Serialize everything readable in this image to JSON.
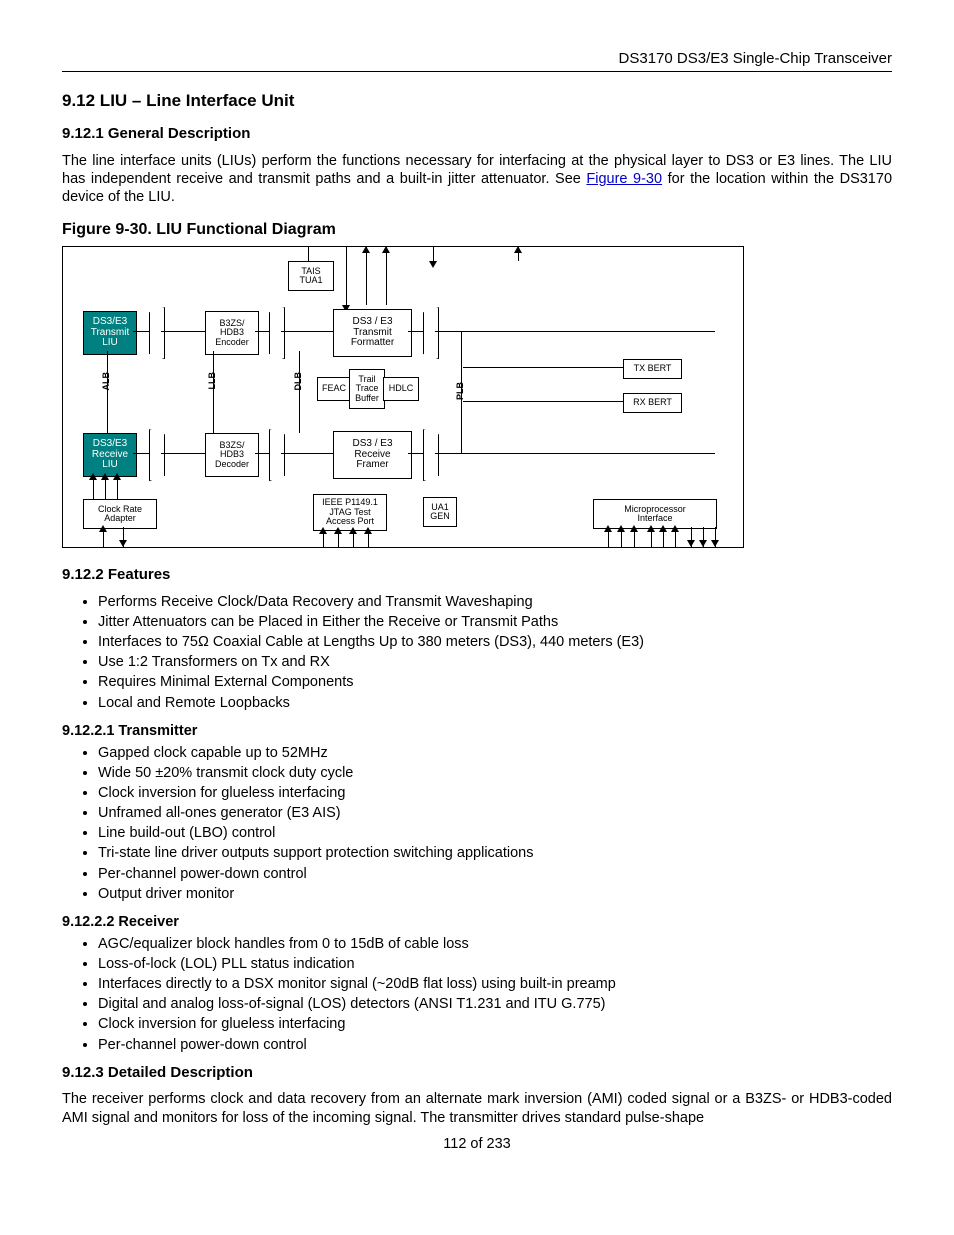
{
  "header": {
    "doc_title": "DS3170 DS3/E3 Single-Chip Transceiver"
  },
  "sec": {
    "h_9_12": "9.12  LIU – Line Interface Unit",
    "h_9_12_1": "9.12.1  General Description",
    "p_9_12_1": "The line interface units (LIUs) perform the functions necessary for interfacing at the physical layer to DS3 or E3 lines. The LIU has independent receive and transmit paths and a built-in jitter attenuator. See ",
    "link_fig": "Figure 9-30",
    "p_9_12_1_tail": " for the location within the DS3170 device of the LIU.",
    "fig_title": "Figure 9-30. LIU Functional Diagram",
    "h_9_12_2": "9.12.2  Features",
    "features": [
      "Performs Receive Clock/Data Recovery and Transmit Waveshaping",
      "Jitter Attenuators can be Placed in Either the Receive or Transmit Paths",
      "Interfaces to 75Ω Coaxial Cable at Lengths Up to 380 meters (DS3), 440 meters (E3)",
      "Use 1:2 Transformers on Tx and RX",
      "Requires Minimal External Components",
      "Local and Remote Loopbacks"
    ],
    "h_9_12_2_1": "9.12.2.1   Transmitter",
    "tx_features": [
      "Gapped clock capable up to 52MHz",
      "Wide 50 ±20% transmit clock duty cycle",
      "Clock inversion for glueless interfacing",
      "Unframed all-ones generator (E3 AIS)",
      "Line build-out (LBO) control",
      "Tri-state line driver outputs support protection switching applications",
      "Per-channel power-down control",
      "Output driver monitor"
    ],
    "h_9_12_2_2": "9.12.2.2   Receiver",
    "rx_features": [
      "AGC/equalizer block handles from 0 to 15dB of cable loss",
      "Loss-of-lock (LOL) PLL status indication",
      "Interfaces directly to a DSX monitor signal (~20dB flat loss) using built-in preamp",
      "Digital and analog loss-of-signal (LOS) detectors (ANSI T1.231 and ITU G.775)",
      "Clock inversion for glueless interfacing",
      "Per-channel power-down control"
    ],
    "h_9_12_3": "9.12.3  Detailed Description",
    "p_9_12_3": "The receiver performs clock and data recovery from an alternate mark inversion (AMI) coded signal or a B3ZS- or HDB3-coded AMI signal and monitors for loss of the incoming signal. The transmitter drives standard pulse-shape"
  },
  "diagram": {
    "tais": "TAIS\nTUA1",
    "tx_liu": "DS3/E3\nTransmit\nLIU",
    "b3zs_enc": "B3ZS/\nHDB3\nEncoder",
    "tx_fmt": "DS3 / E3\nTransmit\nFormatter",
    "feac": "FEAC",
    "ttb": "Trail\nTrace\nBuffer",
    "hdlc": "HDLC",
    "tx_bert": "TX BERT",
    "rx_bert": "RX BERT",
    "rx_liu": "DS3/E3\nReceive\nLIU",
    "b3zs_dec": "B3ZS/\nHDB3\nDecoder",
    "rx_frm": "DS3 / E3\nReceive\nFramer",
    "clk_adp": "Clock Rate\nAdapter",
    "jtag": "IEEE P1149.1\nJTAG Test\nAccess Port",
    "ua1": "UA1\nGEN",
    "mpi": "Microprocessor\nInterface",
    "alb": "ALB",
    "llb": "LLB",
    "dlb": "DLB",
    "plb": "PLB"
  },
  "footer": {
    "page": "112 of 233"
  }
}
